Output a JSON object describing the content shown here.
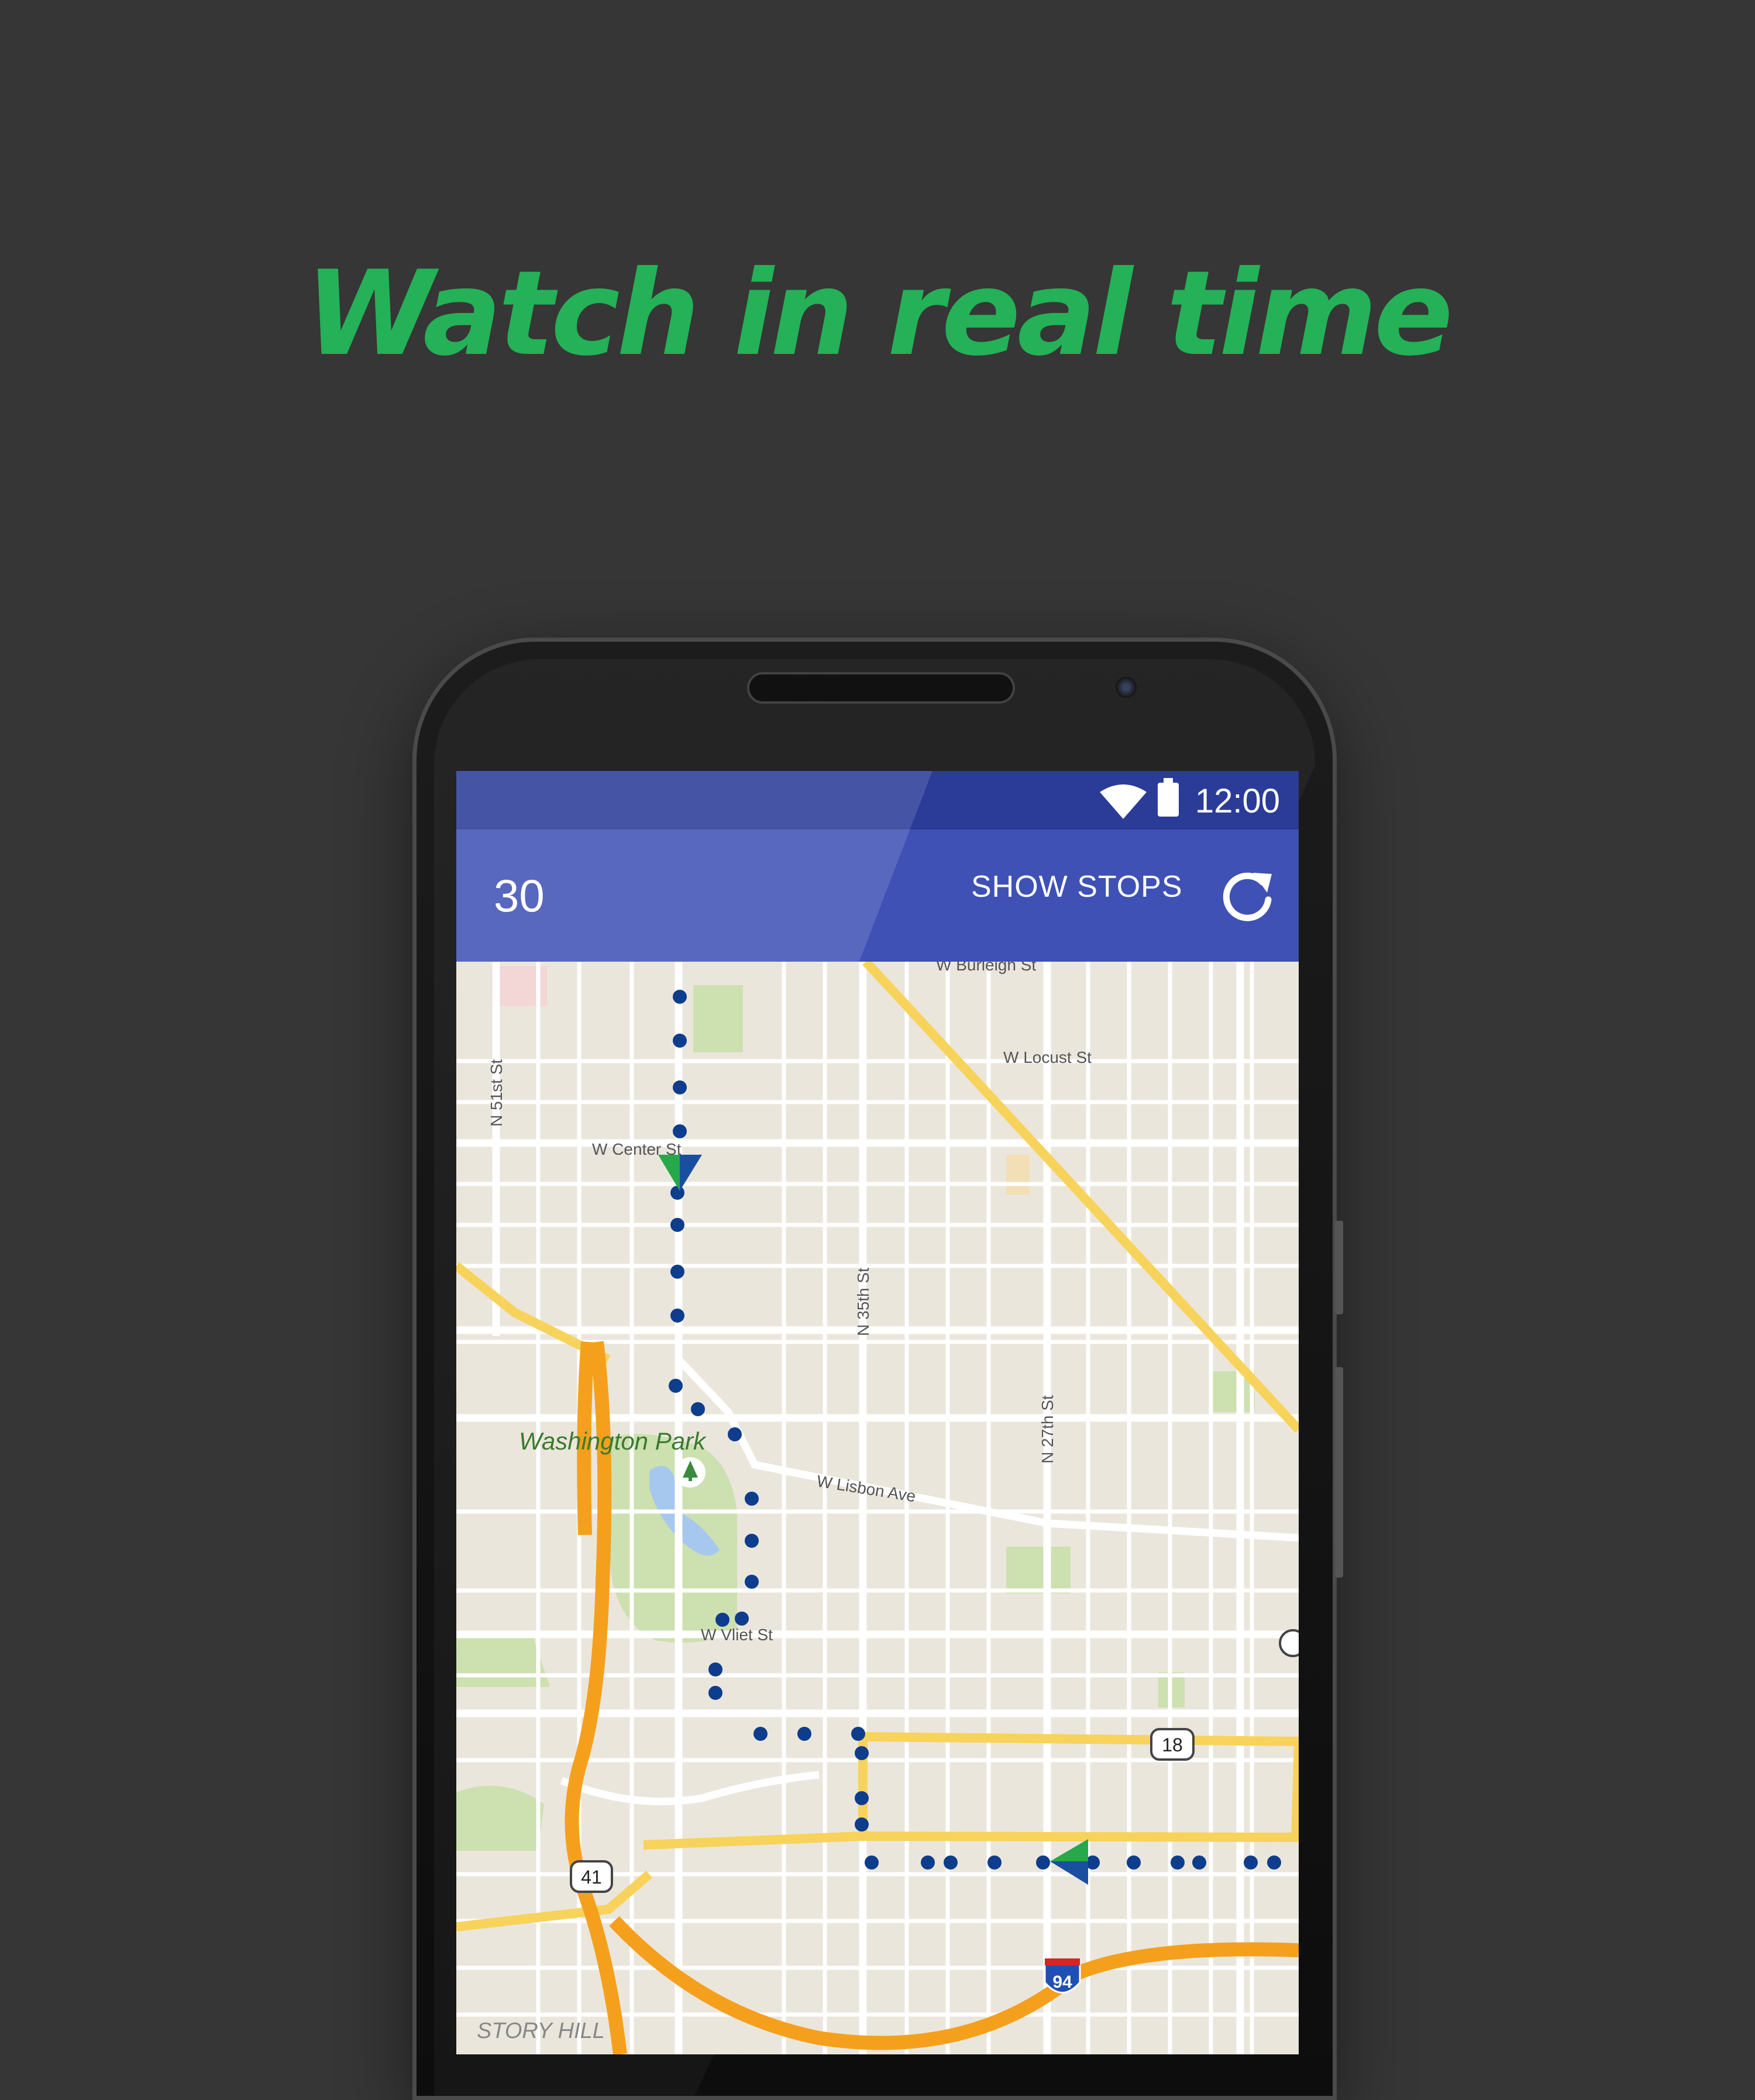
{
  "headline": "Watch in real time",
  "status_bar": {
    "time": "12:00",
    "icons": [
      "wifi-icon",
      "battery-icon"
    ]
  },
  "app_bar": {
    "title": "30",
    "action_label": "SHOW STOPS",
    "refresh_icon": "refresh-icon"
  },
  "map": {
    "street_labels": {
      "burleigh": "W Burleigh St",
      "locust": "W Locust St",
      "n51": "N 51st St",
      "center": "W Center St",
      "n35": "N 35th St",
      "n27": "N 27th St",
      "lisbon": "W Lisbon Ave",
      "vliet": "W Vliet St",
      "park": "Washington Park",
      "neighborhood": "STORY HILL"
    },
    "shields": {
      "us18": "18",
      "us41": "41",
      "i94": "94"
    },
    "colors": {
      "route_dots": "#0d3d8c",
      "bus_green": "#27a84a",
      "bus_blue": "#1a4fa0",
      "highway": "#f5a01c",
      "arterial": "#f7d35b"
    }
  }
}
